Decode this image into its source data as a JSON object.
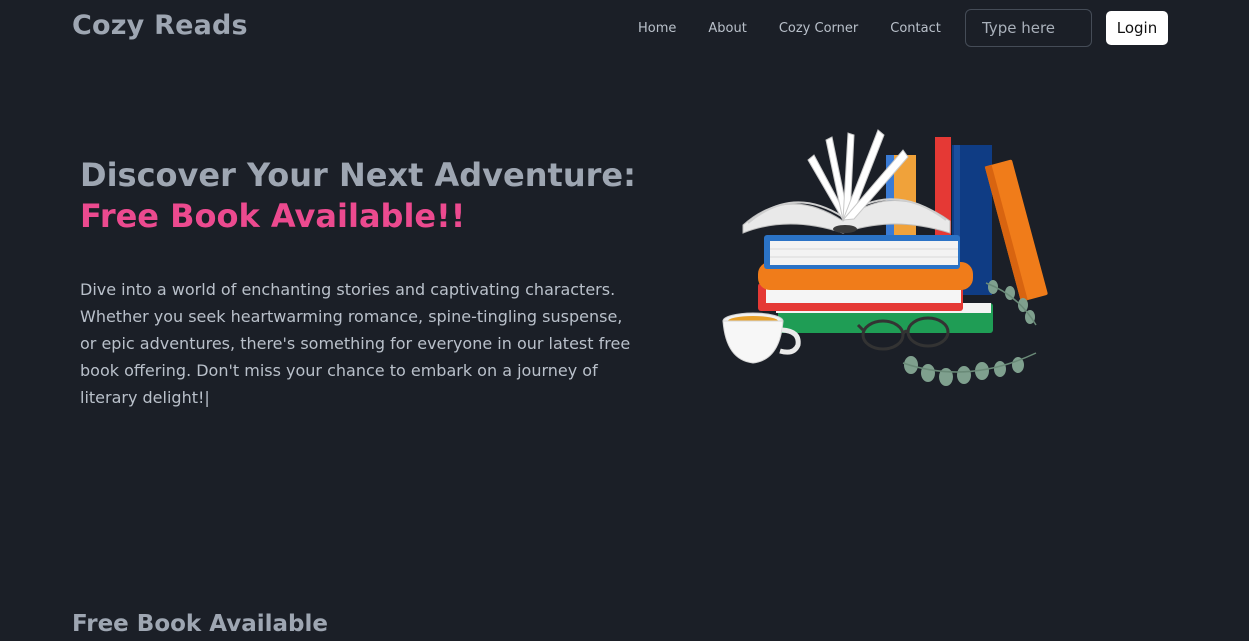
{
  "header": {
    "brand": "Cozy Reads",
    "nav": [
      "Home",
      "About",
      "Cozy Corner",
      "Contact"
    ],
    "search_placeholder": "Type here",
    "login_label": "Login"
  },
  "hero": {
    "title_line1": "Discover Your Next Adventure:",
    "title_line2": "Free Book Available!!",
    "description": "Dive into a world of enchanting stories and captivating characters. Whether you seek heartwarming romance, spine-tingling suspense, or epic adventures, there's something for everyone in our latest free book offering. Don't miss your chance to embark on a journey of literary delight!",
    "caret": "|",
    "image_icon": "book-stack-illustration"
  },
  "section": {
    "title": "Free Book Available"
  },
  "colors": {
    "background": "#1b1f27",
    "muted_text": "#9ea6b2",
    "accent_pink": "#ec4a8f"
  }
}
